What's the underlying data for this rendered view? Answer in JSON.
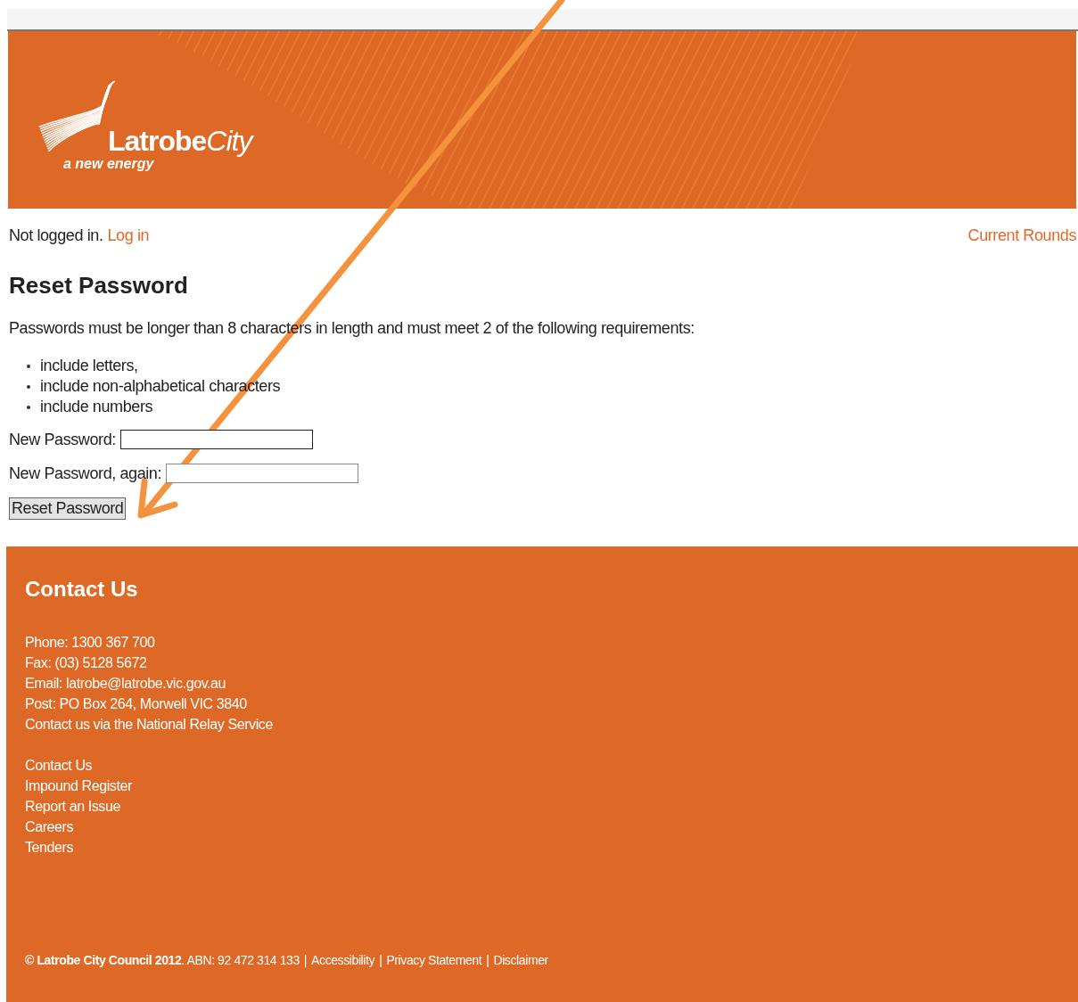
{
  "header": {
    "logo": {
      "name_bold": "Latrobe",
      "name_light": "City",
      "tagline": "a new energy"
    }
  },
  "login_bar": {
    "status": "Not logged in.",
    "link": "Log in",
    "right_link": "Current Rounds"
  },
  "main": {
    "title": "Reset Password",
    "intro": "Passwords must be longer than 8 characters in length and must meet 2 of the following requirements:",
    "requirements": [
      "include letters,",
      "include non-alphabetical characters",
      "include numbers"
    ],
    "fields": [
      {
        "label": "New Password:"
      },
      {
        "label": "New Password, again:"
      }
    ],
    "submit": "Reset Password"
  },
  "footer": {
    "title": "Contact Us",
    "contact": [
      "Phone: 1300 367 700",
      "Fax: (03) 5128 5672",
      "Email: latrobe@latrobe.vic.gov.au",
      "Post: PO Box 264, Morwell VIC 3840",
      "Contact us via the National Relay Service"
    ],
    "links": [
      "Contact Us",
      "Impound Register",
      "Report an Issue",
      "Careers",
      "Tenders"
    ],
    "legal": "**© Latrobe City Council 2012**. ABN: 92 472 314 133",
    "separator": "|",
    "legal_links": [
      "Accessibility",
      "Privacy Statement",
      "Disclaimer"
    ]
  },
  "annotation": {
    "kind": "arrow"
  }
}
